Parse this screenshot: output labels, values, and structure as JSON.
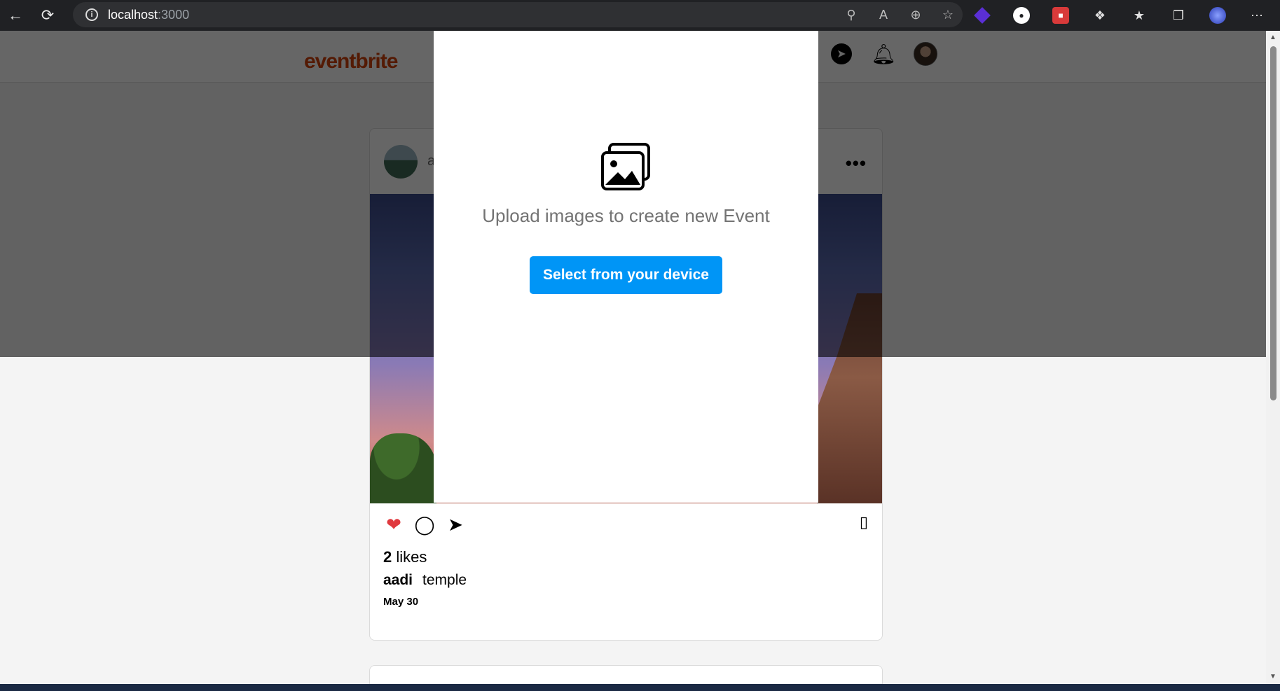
{
  "browser": {
    "url_host": "localhost",
    "url_port": ":3000"
  },
  "app": {
    "logo": "eventbrite"
  },
  "post": {
    "username_partial": "a",
    "more": "•••",
    "likes_count": "2",
    "likes_label": "likes",
    "caption_user": "aadi",
    "caption_text": "temple",
    "date": "May 30"
  },
  "modal": {
    "message": "Upload images to create new Event",
    "button_label": "Select from your device"
  },
  "colors": {
    "brand": "#d1410c",
    "primary_button": "#0095f6",
    "like": "#e0393e"
  }
}
